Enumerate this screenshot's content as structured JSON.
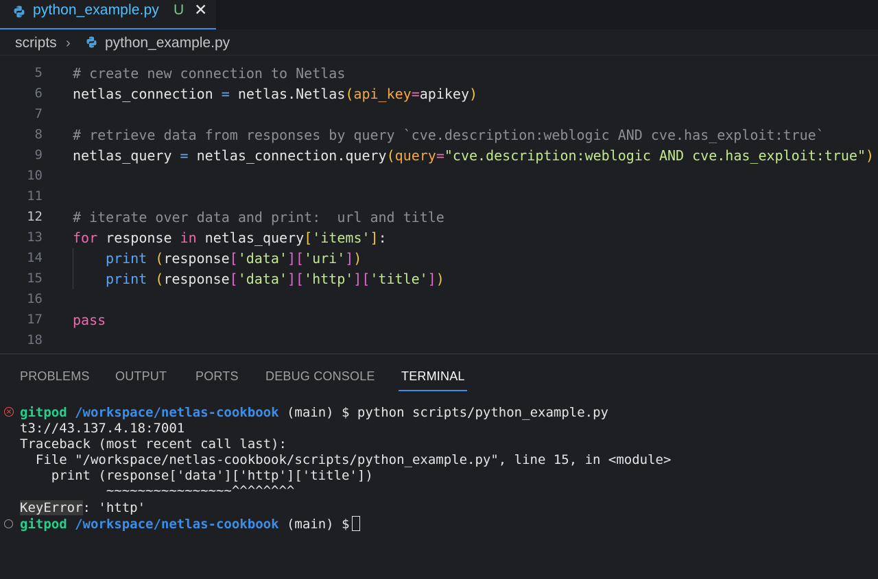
{
  "tab": {
    "title": "python_example.py",
    "status": "U",
    "close": "✕",
    "icon": "python-icon"
  },
  "breadcrumb": {
    "folder": "scripts",
    "sep": "›",
    "file": "python_example.py"
  },
  "editor": {
    "line_numbers": [
      "5",
      "6",
      "7",
      "8",
      "9",
      "10",
      "11",
      "12",
      "13",
      "14",
      "15",
      "16",
      "17",
      "18"
    ],
    "active_line": "12",
    "l5": "# create new connection to Netlas",
    "l6": {
      "var": "netlas_connection",
      "eq": " = ",
      "obj": "netlas.Netlas",
      "open": "(",
      "param": "api_key",
      "assign": "=",
      "val": "apikey",
      "close": ")"
    },
    "l8": "# retrieve data from responses by query `cve.description:weblogic AND cve.has_exploit:true`",
    "l9": {
      "var": "netlas_query",
      "eq": " = ",
      "obj": "netlas_connection.query",
      "open": "(",
      "param": "query",
      "assign": "=",
      "str": "\"cve.description:weblogic AND cve.has_exploit:true\"",
      "close": ")"
    },
    "l12": "# iterate over data and print:  url and title",
    "l13": {
      "kw_for": "for",
      "var": " response ",
      "kw_in": "in",
      "obj": " netlas_query",
      "ob": "[",
      "str": "'items'",
      "cb": "]",
      "colon": ":"
    },
    "l14": {
      "fn": "print",
      "sp": " ",
      "open": "(",
      "obj": "response",
      "ob1": "[",
      "s1": "'data'",
      "cb1": "]",
      "ob2": "[",
      "s2": "'uri'",
      "cb2": "]",
      "close": ")"
    },
    "l15": {
      "fn": "print",
      "sp": " ",
      "open": "(",
      "obj": "response",
      "ob1": "[",
      "s1": "'data'",
      "cb1": "]",
      "ob2": "[",
      "s2": "'http'",
      "cb2": "]",
      "ob3": "[",
      "s3": "'title'",
      "cb3": "]",
      "close": ")"
    },
    "l17": "pass"
  },
  "panel": {
    "tabs": [
      "PROBLEMS",
      "OUTPUT",
      "PORTS",
      "DEBUG CONSOLE",
      "TERMINAL"
    ],
    "active_tab": "TERMINAL"
  },
  "terminal": {
    "user": "gitpod",
    "path": "/workspace/netlas-cookbook",
    "branch": " (main) $ ",
    "command": "python scripts/python_example.py",
    "out1": "t3://43.137.4.18:7001",
    "out2": "Traceback (most recent call last):",
    "out3": "  File \"/workspace/netlas-cookbook/scripts/python_example.py\", line 15, in <module>",
    "out4": "    print (response['data']['http']['title'])",
    "out5": "           ~~~~~~~~~~~~~~~~^^^^^^^^",
    "err_name": "KeyError",
    "err_msg": ": 'http'",
    "prompt_end": " (main) $"
  },
  "colors": {
    "accent": "#3b8eea",
    "prompt_user": "#23d18b",
    "prompt_path": "#3b8eea",
    "error": "#f14c4c"
  }
}
